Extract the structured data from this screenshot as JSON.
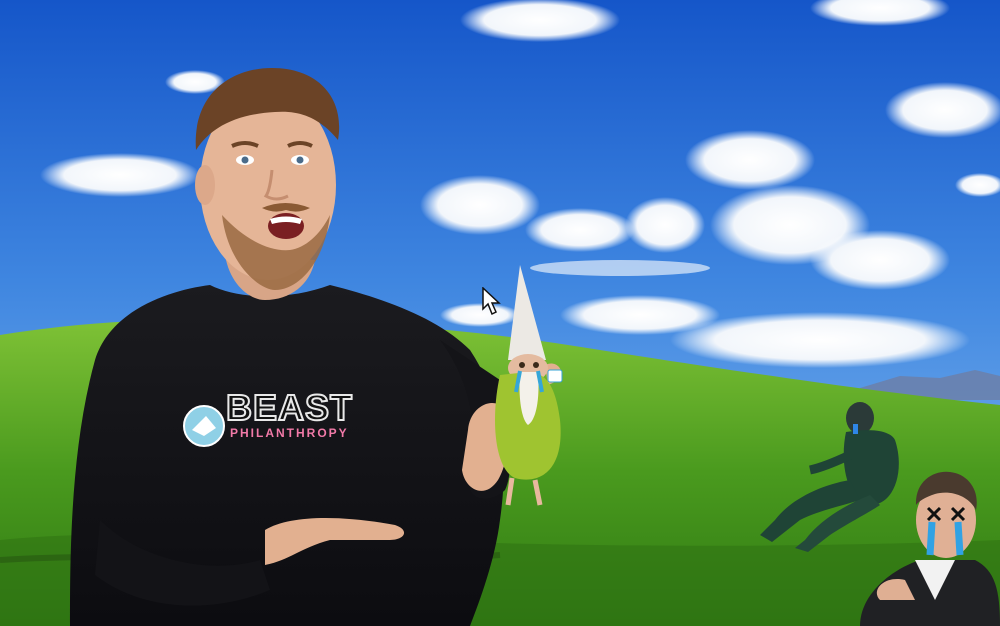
{
  "shirt": {
    "brand": "BEAST",
    "subtitle": "PHILANTHROPY"
  },
  "icons": {
    "cursor": "mouse-pointer-icon"
  }
}
